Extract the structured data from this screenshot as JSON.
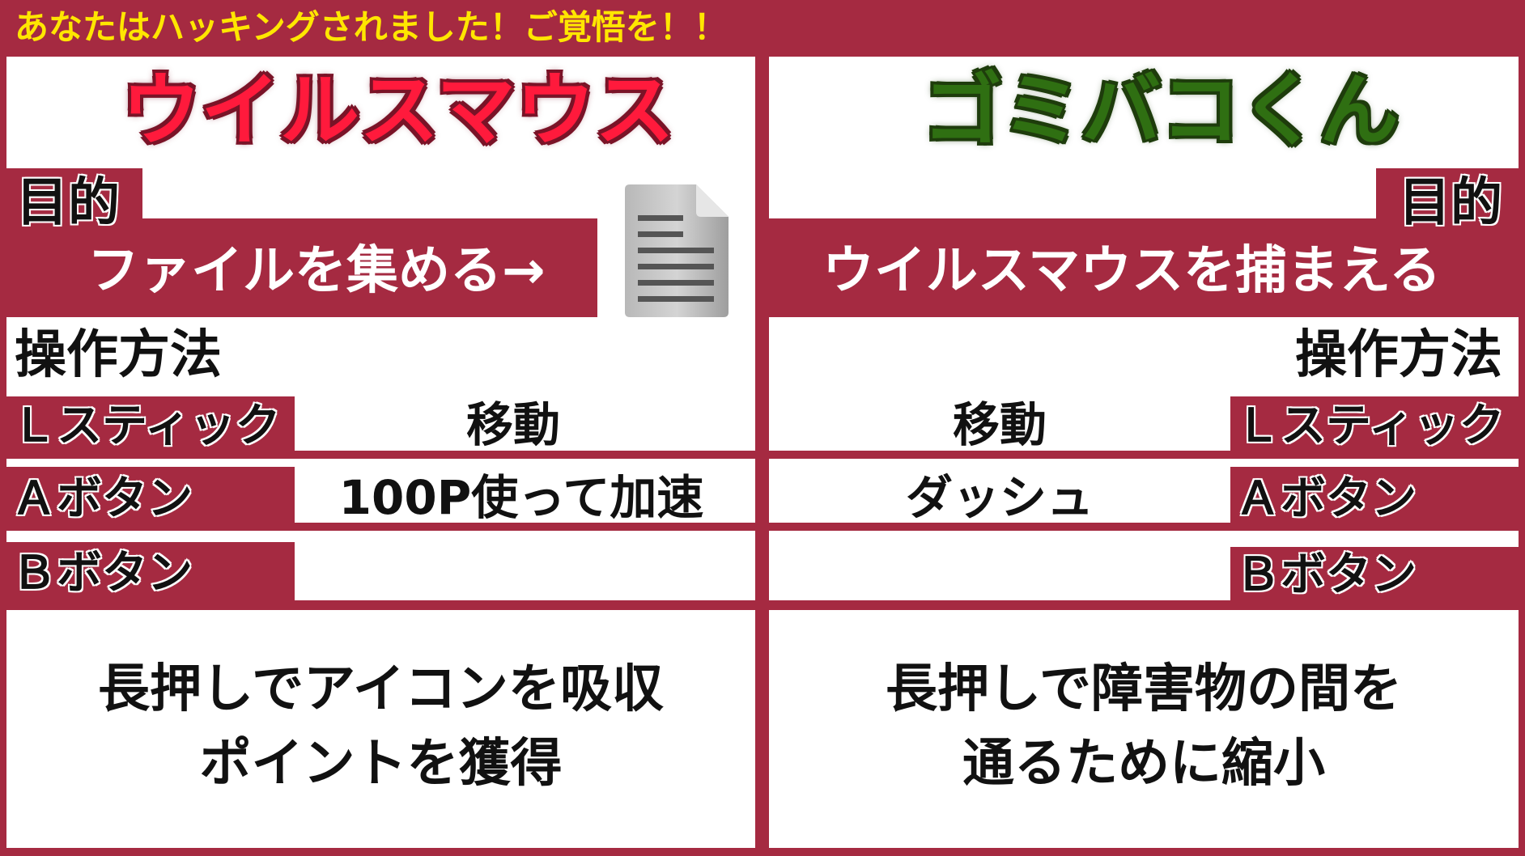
{
  "banner": "あなたはハッキングされました！ご覚悟を！！",
  "left": {
    "title": "ウイルスマウス",
    "objective_label": "目的",
    "objective": "ファイルを集める→",
    "controls_label": "操作方法",
    "controls": [
      {
        "button": "Ｌスティック",
        "action": "移動"
      },
      {
        "button": "Ａボタン",
        "action": "100P使って加速"
      },
      {
        "button": "Ｂボタン",
        "action": ""
      }
    ],
    "description": [
      "長押しでアイコンを吸収",
      "ポイントを獲得"
    ]
  },
  "right": {
    "title": "ゴミバコくん",
    "objective_label": "目的",
    "objective": "ウイルスマウスを捕まえる",
    "controls_label": "操作方法",
    "controls": [
      {
        "button": "Ｌスティック",
        "action": "移動"
      },
      {
        "button": "Ａボタン",
        "action": "ダッシュ"
      },
      {
        "button": "Ｂボタン",
        "action": ""
      }
    ],
    "description": [
      "長押しで障害物の間を",
      "通るために縮小"
    ]
  },
  "icons": {
    "file": "document-icon"
  },
  "colors": {
    "frame": "#a52a41",
    "banner_text": "#ffe600",
    "left_title": "#ff1a3c",
    "right_title": "#2f6f12"
  }
}
